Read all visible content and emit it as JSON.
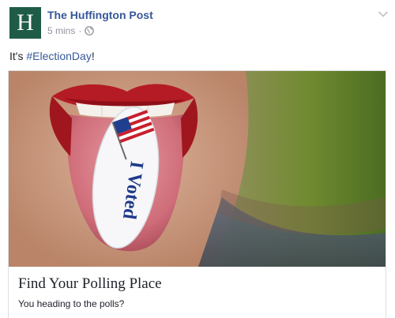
{
  "post": {
    "page_name": "The Huffington Post",
    "avatar_letter": "H",
    "timestamp": "5 mins",
    "separator": "·",
    "audience_icon": "globe-icon",
    "options_icon": "chevron-down-icon",
    "message_prefix": "It's ",
    "hashtag": "#ElectionDay",
    "message_suffix": "!"
  },
  "attachment": {
    "image_alt": "Tongue with I Voted sticker",
    "sticker_text": "I Voted",
    "title": "Find Your Polling Place",
    "description": "You heading to the polls?"
  },
  "colors": {
    "link_blue": "#365899",
    "avatar_green": "#1f5c48",
    "meta_gray": "#90949c",
    "text": "#1d2129",
    "border": "#dddfe2"
  }
}
